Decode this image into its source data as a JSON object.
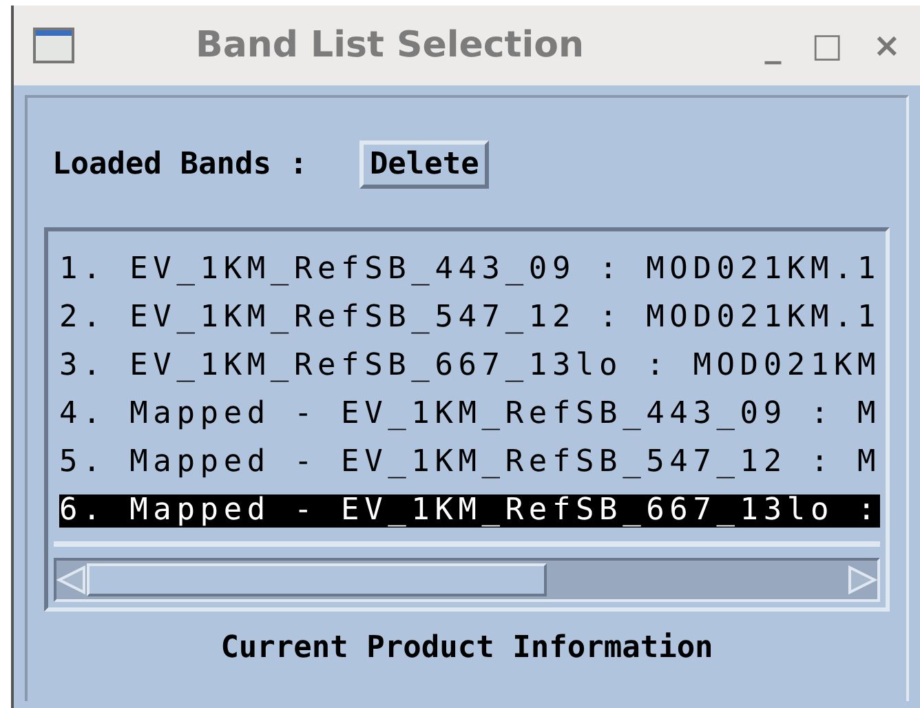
{
  "window": {
    "title": "Band List Selection",
    "controls": [
      "_",
      "□",
      "×"
    ]
  },
  "header": {
    "label": "Loaded Bands :",
    "button": "Delete"
  },
  "bands": [
    {
      "text": "1. EV_1KM_RefSB_443_09 : MOD021KM.1",
      "selected": false
    },
    {
      "text": "2. EV_1KM_RefSB_547_12 : MOD021KM.1",
      "selected": false
    },
    {
      "text": "3. EV_1KM_RefSB_667_13lo : MOD021KM",
      "selected": false
    },
    {
      "text": "4. Mapped - EV_1KM_RefSB_443_09 : M",
      "selected": false
    },
    {
      "text": "5. Mapped - EV_1KM_RefSB_547_12 : M",
      "selected": false
    },
    {
      "text": "6. Mapped - EV_1KM_RefSB_667_13lo :",
      "selected": true
    }
  ],
  "footer": {
    "label": "Current Product Information"
  }
}
